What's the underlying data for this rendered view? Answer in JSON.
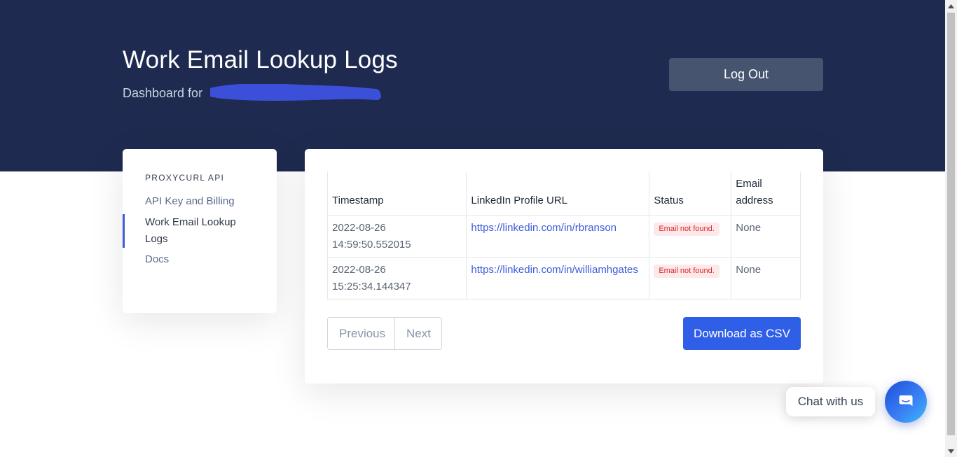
{
  "header": {
    "title": "Work Email Lookup Logs",
    "subtitle_prefix": "Dashboard for",
    "logout_label": "Log Out"
  },
  "sidebar": {
    "heading": "PROXYCURL API",
    "items": [
      {
        "label": "API Key and Billing",
        "active": false
      },
      {
        "label": "Work Email Lookup Logs",
        "active": true
      },
      {
        "label": "Docs",
        "active": false
      }
    ]
  },
  "table": {
    "columns": [
      "Timestamp",
      "LinkedIn Profile URL",
      "Status",
      "Email address"
    ],
    "rows": [
      {
        "timestamp_date": "2022-08-26",
        "timestamp_time": "14:59:50.552015",
        "url": "https://linkedin.com/in/rbranson",
        "status": "Email not found.",
        "email": "None"
      },
      {
        "timestamp_date": "2022-08-26",
        "timestamp_time": "15:25:34.144347",
        "url": "https://linkedin.com/in/williamhgates",
        "status": "Email not found.",
        "email": "None"
      }
    ]
  },
  "pagination": {
    "previous_label": "Previous",
    "next_label": "Next"
  },
  "actions": {
    "download_label": "Download as CSV"
  },
  "chat": {
    "label": "Chat with us",
    "icon": "chat-bubble-icon"
  },
  "colors": {
    "hero_bg": "#1e2a4f",
    "primary": "#2f5fe6",
    "status_bg": "#fde8ea",
    "status_text": "#dc2626",
    "redaction": "#3b4fd8"
  }
}
